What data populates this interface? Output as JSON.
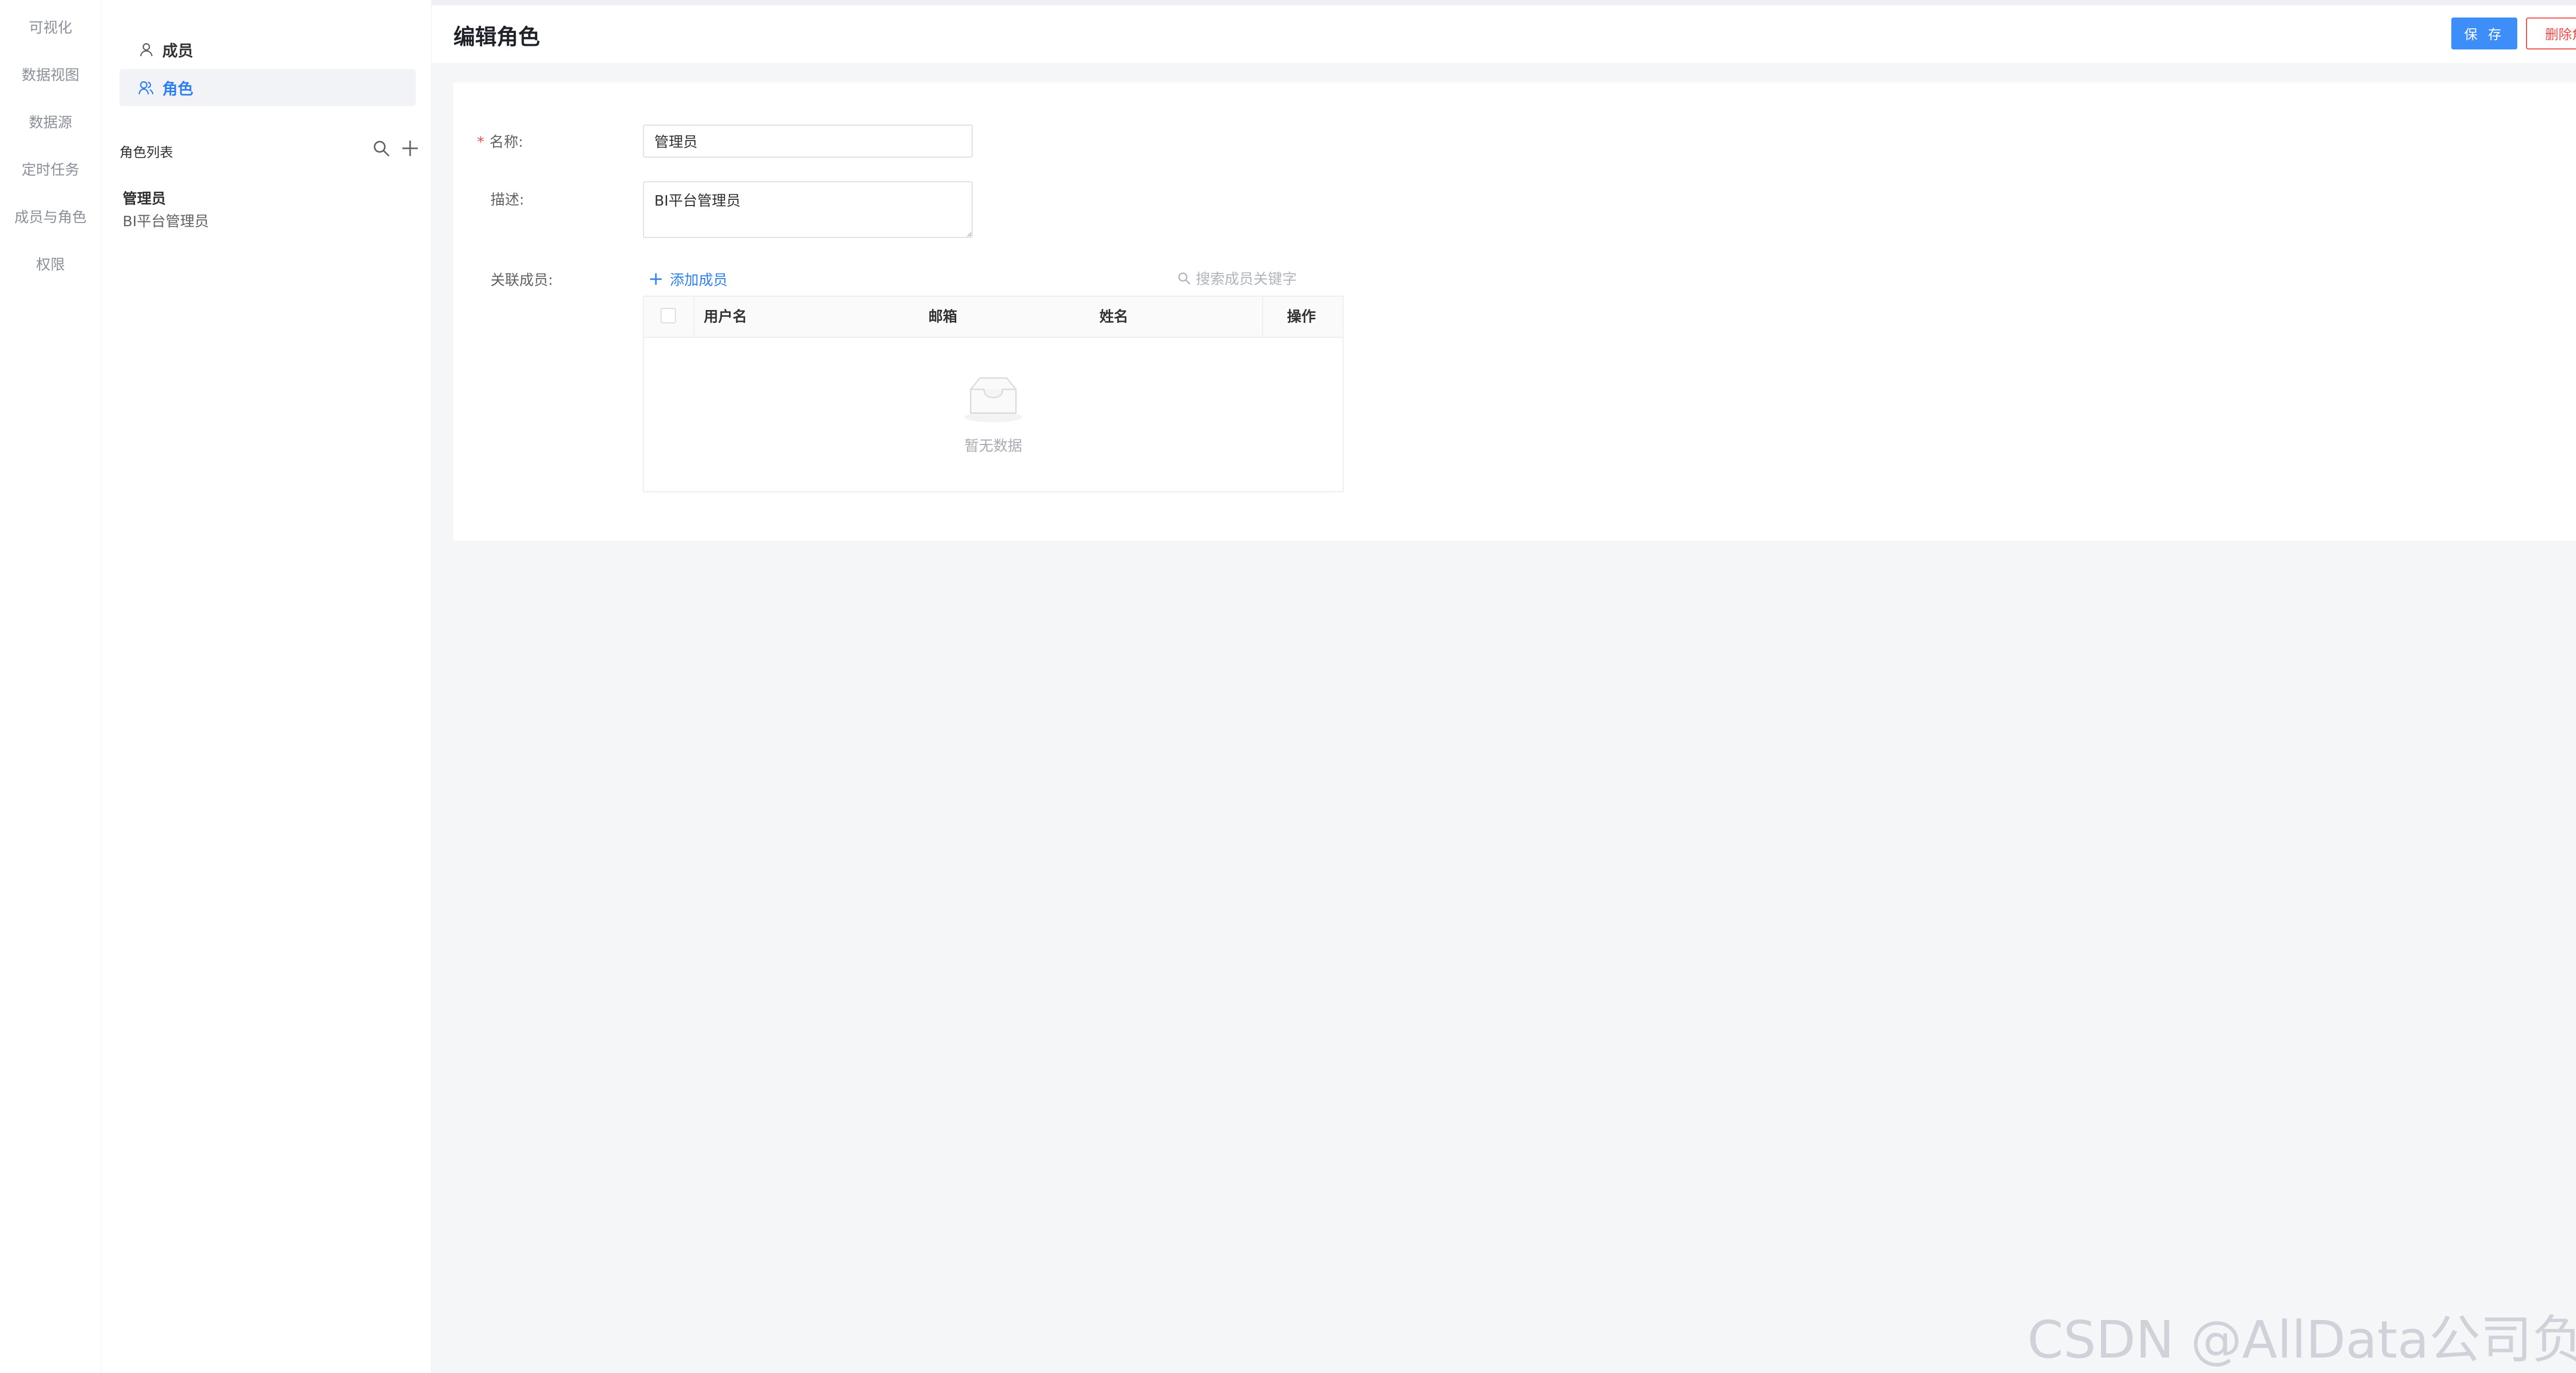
{
  "left_nav": {
    "items": [
      {
        "label": "可视化"
      },
      {
        "label": "数据视图"
      },
      {
        "label": "数据源"
      },
      {
        "label": "定时任务"
      },
      {
        "label": "成员与角色"
      },
      {
        "label": "权限"
      }
    ]
  },
  "sidebar": {
    "items": [
      {
        "label": "成员",
        "icon": "user-icon",
        "active": false
      },
      {
        "label": "角色",
        "icon": "role-icon",
        "active": true
      }
    ],
    "role_list_label": "角色列表",
    "roles": [
      {
        "name": "管理员",
        "description": "BI平台管理员"
      }
    ]
  },
  "header": {
    "title": "编辑角色",
    "save_label": "保 存",
    "delete_label": "删除角色"
  },
  "form": {
    "name_label": "名称:",
    "name_value": "管理员",
    "desc_label": "描述:",
    "desc_value": "BI平台管理员",
    "members_label": "关联成员:",
    "add_member_label": "添加成员",
    "search_placeholder": "搜索成员关键字"
  },
  "table": {
    "columns": [
      "用户名",
      "邮箱",
      "姓名",
      "操作"
    ],
    "rows": [],
    "empty_text": "暂无数据"
  },
  "watermark": "CSDN @AllData公司负责人",
  "colors": {
    "primary": "#3d8ef8",
    "danger": "#f04b4b",
    "background": "#f5f6f8"
  }
}
